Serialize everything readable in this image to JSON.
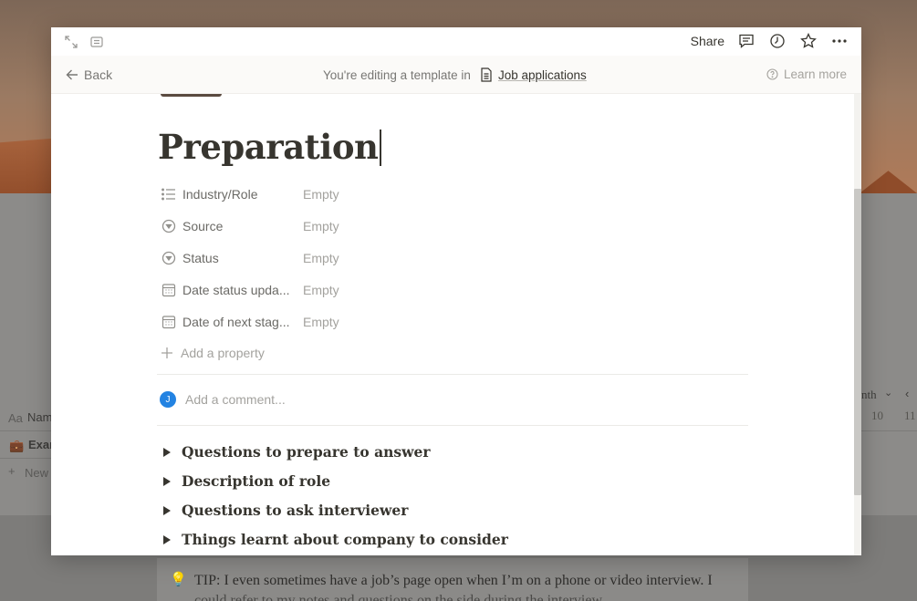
{
  "background": {
    "name_column_prefix": "Aa",
    "name_column": "Nam",
    "row_text": "Exar",
    "new_label": "New",
    "month_label": "nth",
    "day_a": "10",
    "day_b": "11",
    "tip_line1": "TIP: I even sometimes have a job’s page open when I’m on a phone or video interview. I",
    "tip_line2": "could refer to my notes and questions on the side during the interview."
  },
  "topbar": {
    "share_label": "Share",
    "icons": [
      "expand-icon",
      "side-peek-icon",
      "comment-icon",
      "history-icon",
      "star-icon",
      "more-icon"
    ]
  },
  "banner": {
    "back_label": "Back",
    "editing_text": "You're editing a template in",
    "database_name": "Job applications",
    "learn_more": "Learn more"
  },
  "page": {
    "title": "Preparation",
    "properties": [
      {
        "name": "Industry/Role",
        "value": "Empty",
        "icon": "list-icon"
      },
      {
        "name": "Source",
        "value": "Empty",
        "icon": "select-icon"
      },
      {
        "name": "Status",
        "value": "Empty",
        "icon": "select-icon"
      },
      {
        "name": "Date status upda...",
        "value": "Empty",
        "icon": "calendar-icon"
      },
      {
        "name": "Date of next stag...",
        "value": "Empty",
        "icon": "calendar-icon"
      }
    ],
    "add_property": "Add a property",
    "comment_avatar": "J",
    "comment_placeholder": "Add a comment...",
    "toggles": [
      "Questions to prepare to answer",
      "Description of role",
      "Questions to ask interviewer",
      "Things learnt about company to consider"
    ]
  },
  "colors": {
    "accent": "#2383e2",
    "text": "#37352f",
    "muted": "#a3a29e"
  }
}
